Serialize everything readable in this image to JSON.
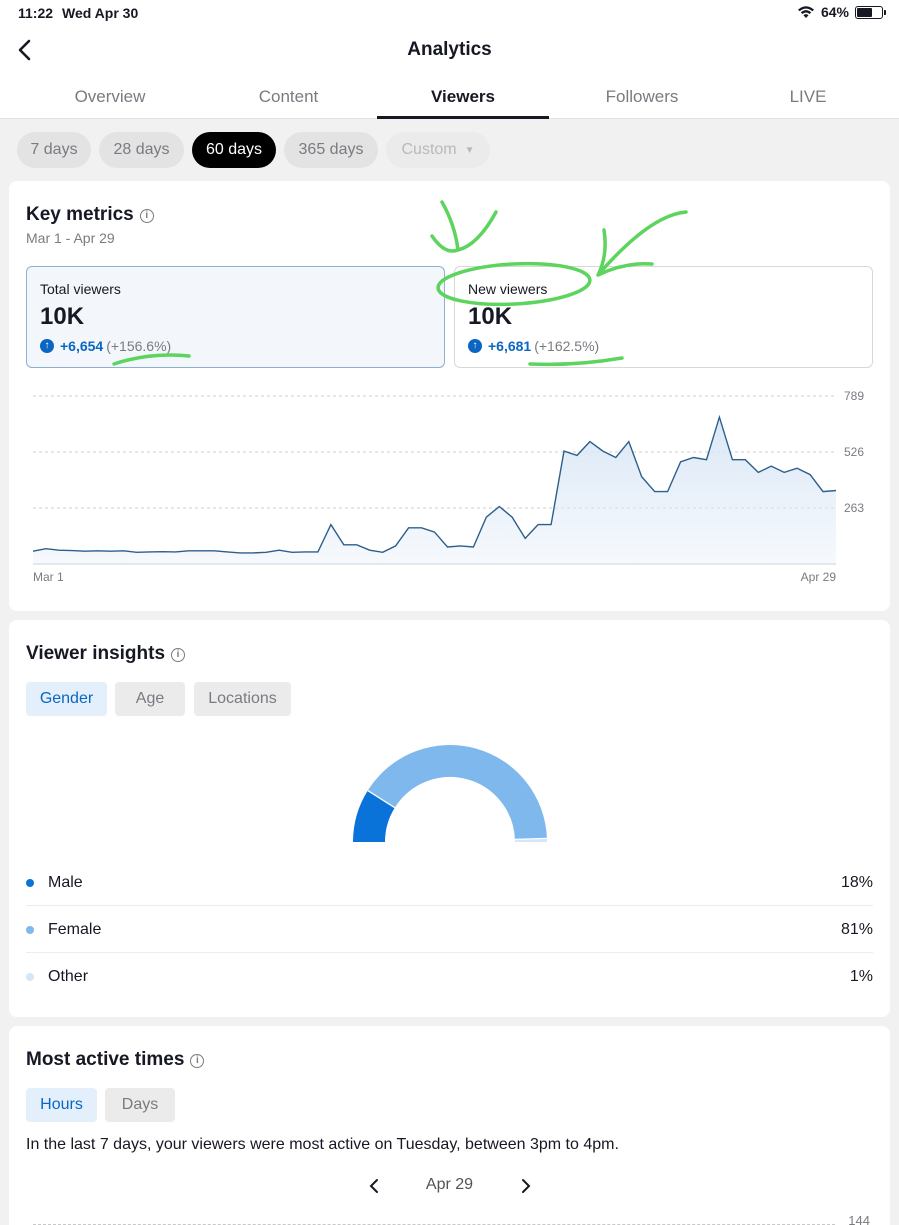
{
  "status_bar": {
    "time": "11:22",
    "date": "Wed Apr 30",
    "battery": "64%",
    "battery_level": 0.64
  },
  "header": {
    "title": "Analytics"
  },
  "tabs": [
    {
      "label": "Overview"
    },
    {
      "label": "Content"
    },
    {
      "label": "Viewers",
      "active": true
    },
    {
      "label": "Followers"
    },
    {
      "label": "LIVE"
    }
  ],
  "periods": [
    {
      "label": "7 days"
    },
    {
      "label": "28 days"
    },
    {
      "label": "60 days",
      "active": true
    },
    {
      "label": "365 days"
    },
    {
      "label": "Custom",
      "disabled": true
    }
  ],
  "key_metrics": {
    "title": "Key metrics",
    "date_range": "Mar 1 - Apr 29",
    "total": {
      "label": "Total viewers",
      "value": "10K",
      "delta": "+6,654",
      "pct": "(+156.6%)"
    },
    "new": {
      "label": "New viewers",
      "value": "10K",
      "delta": "+6,681",
      "pct": "(+162.5%)"
    }
  },
  "chart_data": {
    "type": "area",
    "x_start_label": "Mar 1",
    "x_end_label": "Apr 29",
    "y_ticks": [
      "789",
      "526",
      "263"
    ],
    "ylim": [
      0,
      789
    ],
    "grid": true,
    "values": [
      60,
      72,
      65,
      63,
      60,
      62,
      60,
      62,
      55,
      57,
      58,
      57,
      62,
      62,
      62,
      57,
      52,
      52,
      55,
      65,
      55,
      57,
      57,
      185,
      90,
      90,
      65,
      55,
      85,
      170,
      170,
      150,
      80,
      85,
      80,
      220,
      270,
      220,
      120,
      185,
      185,
      530,
      510,
      575,
      530,
      500,
      575,
      410,
      340,
      340,
      480,
      500,
      490,
      690,
      490,
      490,
      430,
      460,
      430,
      450,
      420,
      340,
      345
    ],
    "line_color": "#2e5f8c",
    "fill_color": "#dbe8f6"
  },
  "viewer_insights": {
    "title": "Viewer insights",
    "segments": [
      {
        "label": "Gender",
        "active": true
      },
      {
        "label": "Age"
      },
      {
        "label": "Locations"
      }
    ],
    "gender": [
      {
        "name": "Male",
        "pct": "18%",
        "value": 18,
        "color": "#0a73d9"
      },
      {
        "name": "Female",
        "pct": "81%",
        "value": 81,
        "color": "#7eb8ed"
      },
      {
        "name": "Other",
        "pct": "1%",
        "value": 1,
        "color": "#d4e7f8"
      }
    ]
  },
  "active_times": {
    "title": "Most active times",
    "segments": [
      {
        "label": "Hours",
        "active": true
      },
      {
        "label": "Days"
      }
    ],
    "description": "In the last 7 days, your viewers were most active on Tuesday, between 3pm to 4pm.",
    "date": "Apr 29",
    "y_tick_top": "144"
  },
  "annotation_color": "#5dd45d"
}
